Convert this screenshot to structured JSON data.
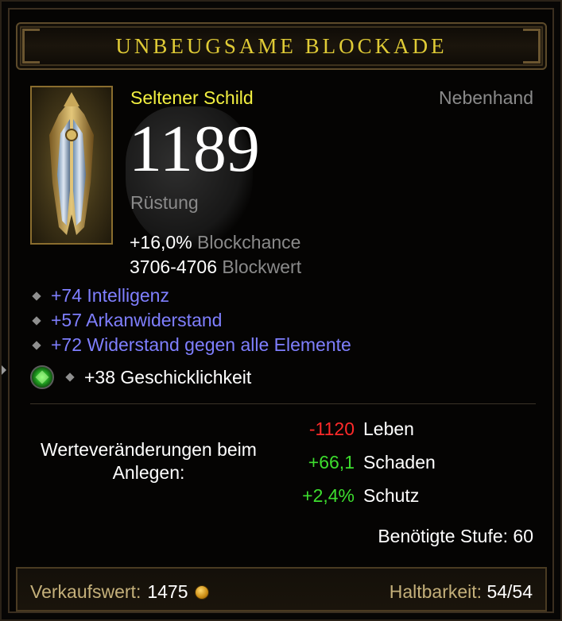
{
  "item": {
    "name": "UNBEUGSAME BLOCKADE",
    "rarity": "Seltener Schild",
    "slot": "Nebenhand",
    "armor_value": "1189",
    "armor_label": "Rüstung",
    "block_chance": {
      "value": "+16,0%",
      "label": "Blockchance"
    },
    "block_value": {
      "value": "3706-4706",
      "label": "Blockwert"
    },
    "affixes": [
      "+74 Intelligenz",
      "+57 Arkanwiderstand",
      "+72 Widerstand gegen alle Elemente"
    ],
    "socket": {
      "gem_icon": "emerald-gem-icon",
      "text": "+38 Geschicklichkeit"
    }
  },
  "stat_changes": {
    "label": "Werteveränderungen beim Anlegen:",
    "rows": [
      {
        "value": "-1120",
        "label": "Leben",
        "color": "#ff2a2a"
      },
      {
        "value": "+66,1",
        "label": "Schaden",
        "color": "#3dde2e"
      },
      {
        "value": "+2,4%",
        "label": "Schutz",
        "color": "#3dde2e"
      }
    ]
  },
  "required_level": "Benötigte Stufe: 60",
  "footer": {
    "sell_label": "Verkaufswert:",
    "sell_value": "1475",
    "durability_label": "Haltbarkeit:",
    "durability_value": "54/54"
  },
  "colors": {
    "title": "#e0cb36",
    "rarity": "#f2ef40",
    "affix": "#7f7fff",
    "gray_text": "#8a8a8a"
  }
}
